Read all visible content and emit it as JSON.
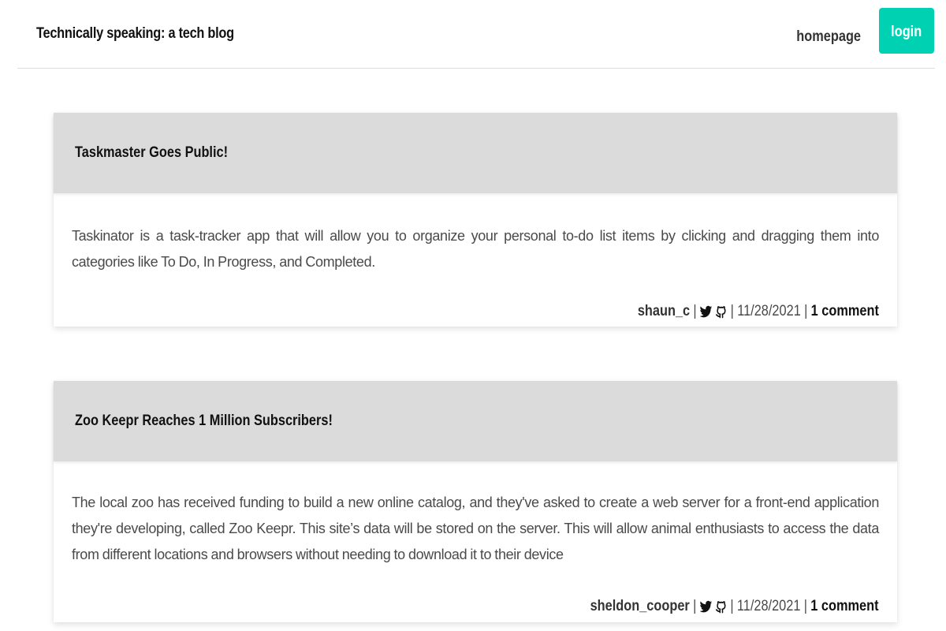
{
  "header": {
    "site_title": "Technically speaking: a tech blog",
    "nav_home": "homepage",
    "login": "login"
  },
  "posts": [
    {
      "title": "Taskmaster Goes Public!",
      "content": "Taskinator is a task-tracker app that will allow you to organize your personal to-do list items by clicking and dragging them into categories like To Do, In Progress, and Completed.",
      "author": "shaun_c",
      "date": "11/28/2021",
      "comments": "1 comment",
      "icons": [
        "twitter-icon",
        "github-icon"
      ]
    },
    {
      "title": "Zoo Keepr Reaches 1 Million Subscribers!",
      "content": "The local zoo has received funding to build a new online catalog, and they've asked to create a web server for a front-end application they're developing, called Zoo Keepr. This site’s data will be stored on the server. This will allow animal enthusiasts to access the data from different locations and browsers without needing to download it to their device",
      "author": "sheldon_cooper",
      "date": "11/28/2021",
      "comments": "1 comment",
      "icons": [
        "twitter-icon",
        "github-icon"
      ]
    }
  ],
  "colors": {
    "accent": "#00d1b2",
    "card_header": "#dbdbdb",
    "body_text": "#4a4a4a"
  }
}
